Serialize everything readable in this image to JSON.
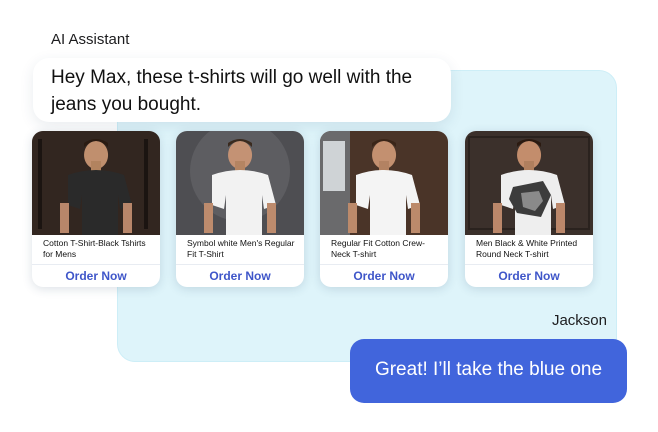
{
  "assistant": {
    "name": "AI Assistant",
    "message": "Hey Max, these t-shirts will go well  with the jeans you bought."
  },
  "products": [
    {
      "title": "Cotton T-Shirt-Black Tshirts for Mens",
      "button": "Order Now",
      "shirt_color": "#2a2a2a",
      "background": "#3a2d26"
    },
    {
      "title": "Symbol white Men's Regular Fit T-Shirt",
      "button": "Order Now",
      "shirt_color": "#f2f2f2",
      "background": "#4e4e52"
    },
    {
      "title": "Regular Fit Cotton Crew-Neck T-shirt",
      "button": "Order Now",
      "shirt_color": "#f4f4f4",
      "background": "#4a3428"
    },
    {
      "title": "Men Black & White Printed Round Neck T-shirt",
      "button": "Order Now",
      "shirt_color": "#eeeeee",
      "background": "#3b302b"
    }
  ],
  "user": {
    "name": "Jackson",
    "message": "Great! I’ll take the blue one"
  },
  "colors": {
    "accent": "#4165dc",
    "panel": "#def4fa",
    "order_text": "#3f56c9"
  }
}
